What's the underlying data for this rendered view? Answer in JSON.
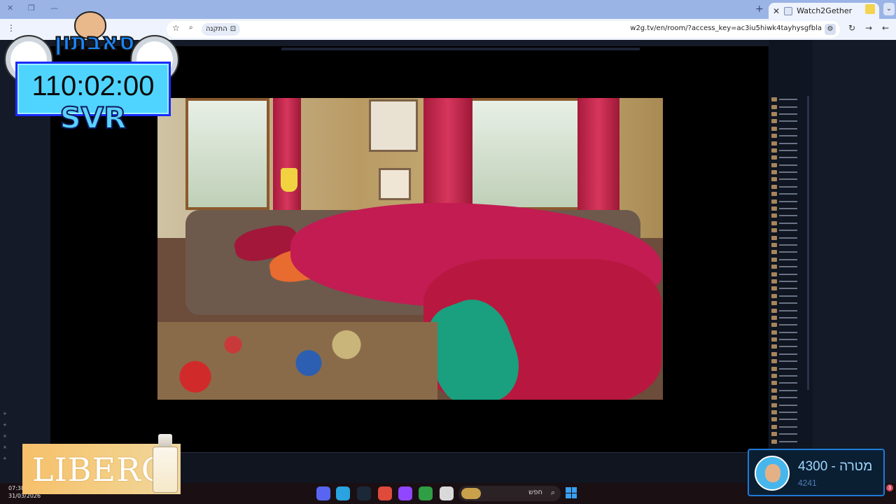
{
  "browser": {
    "tab_title": "Watch2Gether",
    "url": "w2g.tv/en/room/?access_key=ac3iu5hiwk4tayhysgfbla",
    "install_label": "התקנה"
  },
  "overlay": {
    "logo_text": "סאבתון",
    "timer": "110:02:00",
    "timer_label": "SVR"
  },
  "sponsor": {
    "text": "LIBERO"
  },
  "goal": {
    "title": "מטרה - 4300",
    "current": "4241"
  },
  "taskbar": {
    "time": "07:38",
    "date": "31/03/2026",
    "search_placeholder": "חפש",
    "notification_count": "3"
  },
  "colors": {
    "accent": "#1f7ad6",
    "timer_bg": "#4fd4ff"
  }
}
